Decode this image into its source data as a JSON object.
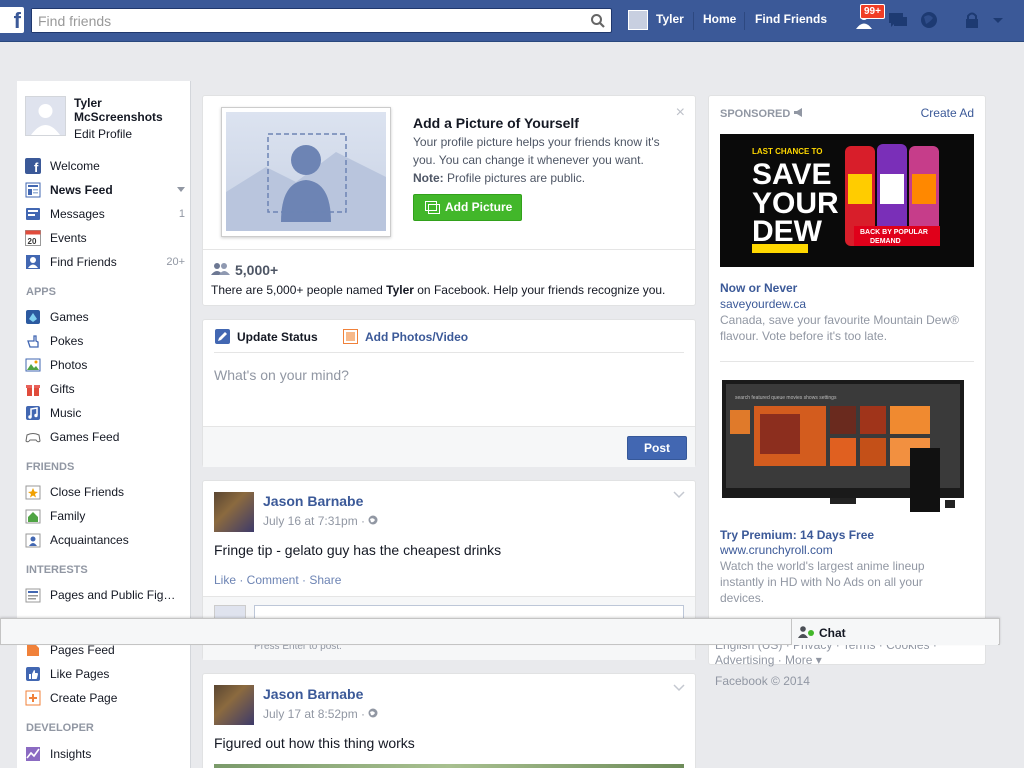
{
  "topbar": {
    "logo_letter": "f",
    "search_placeholder": "Find friends",
    "user_name": "Tyler",
    "home_label": "Home",
    "find_friends_label": "Find Friends",
    "friend_requests_badge": "99+",
    "icons": [
      "search-icon",
      "friend-requests-icon",
      "messages-icon",
      "notifications-icon",
      "privacy-icon",
      "settings-arrow-icon"
    ],
    "bar_color": "#3b5998"
  },
  "sidebar": {
    "profile_name_line1": "Tyler",
    "profile_name_line2": "McScreenshots",
    "edit_profile": "Edit Profile",
    "items": [
      {
        "label": "Welcome",
        "count": "",
        "icon": "welcome-icon"
      },
      {
        "label": "News Feed",
        "count": "",
        "icon": "news-feed-icon"
      },
      {
        "label": "Messages",
        "count": "1",
        "icon": "messages-icon"
      },
      {
        "label": "Events",
        "count": "",
        "icon": "events-icon",
        "icon_text": "20"
      },
      {
        "label": "Find Friends",
        "count": "20+",
        "icon": "find-friends-icon"
      }
    ],
    "apps_header": "APPS",
    "apps": [
      {
        "label": "Games",
        "icon": "games-icon"
      },
      {
        "label": "Pokes",
        "icon": "pokes-icon"
      },
      {
        "label": "Photos",
        "icon": "photos-icon"
      },
      {
        "label": "Gifts",
        "icon": "gifts-icon"
      },
      {
        "label": "Music",
        "icon": "music-icon"
      },
      {
        "label": "Games Feed",
        "icon": "games-feed-icon"
      }
    ],
    "friends_header": "FRIENDS",
    "friends": [
      {
        "label": "Close Friends",
        "icon": "close-friends-icon"
      },
      {
        "label": "Family",
        "icon": "family-icon"
      },
      {
        "label": "Acquaintances",
        "icon": "acquaintances-icon"
      }
    ],
    "interests_header": "INTERESTS",
    "interests": [
      {
        "label": "Pages and Public Fig…",
        "icon": "pages-public-figures-icon"
      }
    ],
    "pages": [
      {
        "label": "Pages Feed",
        "icon": "pages-feed-icon"
      },
      {
        "label": "Like Pages",
        "icon": "like-pages-icon"
      },
      {
        "label": "Create Page",
        "icon": "create-page-icon"
      }
    ],
    "developer_header": "DEVELOPER",
    "developer": [
      {
        "label": "Insights",
        "icon": "insights-icon"
      }
    ]
  },
  "profile_prompt": {
    "title": "Add a Picture of Yourself",
    "desc_line1": "Your profile picture helps your friends know it's",
    "desc_line2": "you. You can change it whenever you want.",
    "note_label": "Note:",
    "note_text": " Profile pictures are public.",
    "button_label": "Add Picture",
    "close": "×",
    "count": "5,000+",
    "count_desc_before": "There are 5,000+ people named ",
    "count_desc_name": "Tyler",
    "count_desc_after": " on Facebook. Help your friends recognize you."
  },
  "composer": {
    "tab_status": "Update Status",
    "tab_photos": "Add Photos/Video",
    "placeholder": "What's on your mind?",
    "post_label": "Post"
  },
  "stories": [
    {
      "author": "Jason Barnabe",
      "time": "July 16 at 7:31pm · ",
      "text": "Fringe tip - gelato guy has the cheapest drinks",
      "actions": "Like · Comment · Share",
      "comment_hint": "Press Enter to post."
    },
    {
      "author": "Jason Barnabe",
      "time": "July 17 at 8:52pm · ",
      "text": "Figured out how this thing works"
    }
  ],
  "ads": {
    "sponsored": "SPONSORED",
    "create_ad": "Create Ad",
    "ad1": {
      "image_text_1": "LAST CHANCE TO",
      "image_text_2": "SAVE",
      "image_text_3": "YOUR",
      "image_text_4": "DEW",
      "image_text_5": "BACK BY POPULAR",
      "image_text_6": "DEMAND",
      "title": "Now or Never",
      "url": "saveyourdew.ca",
      "desc": "Canada, save your favourite Mountain Dew® flavour. Vote before it's too late."
    },
    "ad2": {
      "tv_menu": "search   featured   queue   movies   shows   settings",
      "title": "Try Premium: 14 Days Free",
      "url": "www.crunchyroll.com",
      "desc": "Watch the world's largest anime lineup instantly in HD with No Ads on all your devices."
    }
  },
  "footer": {
    "links_line1": "English (US) · Privacy · Terms · Cookies ·",
    "links_line2": "Advertising · More ▾",
    "copyright": "Facebook © 2014"
  },
  "chat": {
    "label": "Chat"
  }
}
